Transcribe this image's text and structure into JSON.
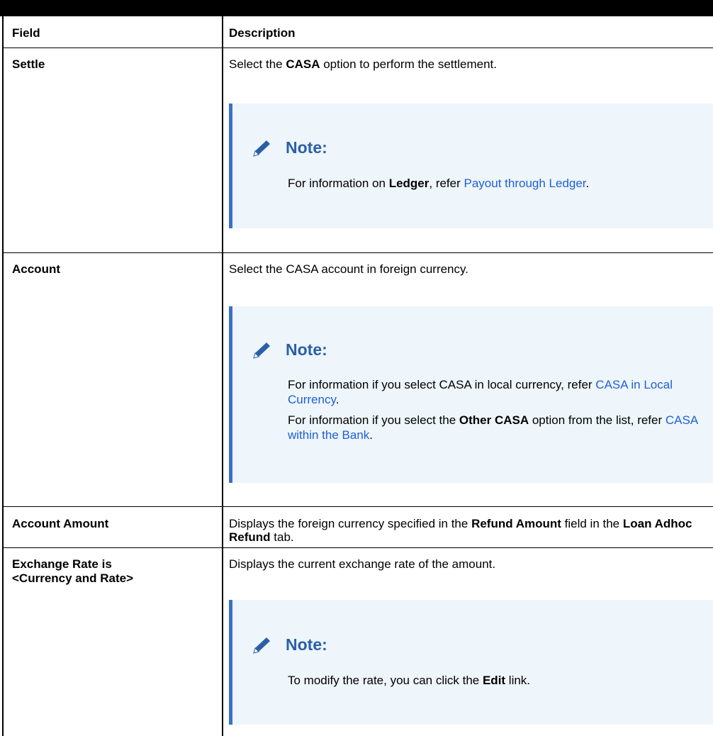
{
  "columns": {
    "field": "Field",
    "description": "Description"
  },
  "rows": [
    {
      "field": "Settle",
      "desc": {
        "pre": "Select the ",
        "bold": "CASA",
        "post": " option to perform the settlement."
      },
      "note": {
        "title": "Note:",
        "line1": {
          "pre": "For information on ",
          "bold": "Ledger",
          "mid": ", refer ",
          "link": "Payout through Ledger",
          "post": "."
        }
      }
    },
    {
      "field": "Account",
      "desc": "Select the CASA account in foreign currency.",
      "note": {
        "title": "Note:",
        "para1": {
          "pre": "For information if you select CASA in local currency, refer ",
          "link": "CASA in Local Currency",
          "post": "."
        },
        "para2": {
          "pre": "For information if you select the ",
          "bold": "Other CASA",
          "mid": " option from the list, refer ",
          "link": "CASA within the Bank",
          "post": "."
        }
      }
    },
    {
      "field": "Account Amount",
      "desc": {
        "pre": "Displays the foreign currency specified in the ",
        "bold1": "Refund Amount",
        "mid": " field in the ",
        "bold2": "Loan Adhoc Refund",
        "post": " tab."
      }
    },
    {
      "field_line1": "Exchange Rate is",
      "field_line2": "<Currency and Rate>",
      "desc": "Displays the current exchange rate of the amount.",
      "note": {
        "title": "Note:",
        "line1": {
          "pre": "To modify the rate, you can click the ",
          "bold": "Edit",
          "post": " link."
        }
      }
    }
  ],
  "colors": {
    "link": "#1f5fd6",
    "note_bg": "#eef5fb",
    "note_border": "#3a72c4",
    "note_title": "#2a5fa8"
  },
  "icons": {
    "note": "pencil-icon"
  }
}
